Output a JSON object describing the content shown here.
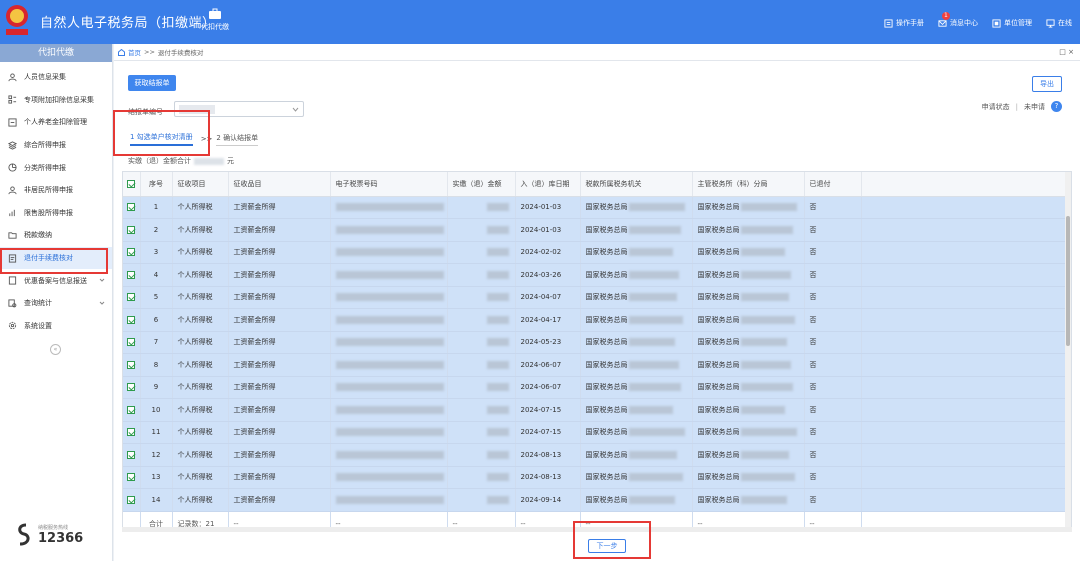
{
  "header": {
    "app_title": "自然人电子税务局（扣缴端）",
    "proxy_label": "代扣代缴",
    "links": [
      {
        "label": "操作手册",
        "icon": "manual-icon"
      },
      {
        "label": "消息中心",
        "icon": "message-icon",
        "badge": "1"
      },
      {
        "label": "单位管理",
        "icon": "org-icon"
      },
      {
        "label": "在线",
        "icon": "online-icon"
      }
    ]
  },
  "sidebar": {
    "title": "代扣代缴",
    "items": [
      {
        "label": "人员信息采集",
        "icon": "person-icon"
      },
      {
        "label": "专项附加扣除信息采集",
        "icon": "list-icon"
      },
      {
        "label": "个人养老金扣除管理",
        "icon": "pension-icon"
      },
      {
        "label": "综合所得申报",
        "icon": "layers-icon"
      },
      {
        "label": "分类所得申报",
        "icon": "pie-icon"
      },
      {
        "label": "非居民所得申报",
        "icon": "nonresident-icon"
      },
      {
        "label": "限售股所得申报",
        "icon": "stock-icon"
      },
      {
        "label": "税款缴纳",
        "icon": "folder-icon"
      },
      {
        "label": "退付手续费核对",
        "icon": "doc-check-icon"
      },
      {
        "label": "优惠备案与信息报送",
        "icon": "file-icon"
      },
      {
        "label": "查询统计",
        "icon": "query-icon"
      },
      {
        "label": "系统设置",
        "icon": "gear-icon"
      }
    ],
    "collapse_glyph": "«",
    "hotline": {
      "number": "12366",
      "caption": "纳税服务热线"
    }
  },
  "breadcrumb": {
    "home": "首页",
    "sep": ">>",
    "current": "退付手续费核对",
    "close": "□ ×"
  },
  "toolbar": {
    "fetch_label": "获取结报单",
    "export_label": "导出"
  },
  "form": {
    "report_no_label": "结报单编号"
  },
  "status": {
    "label": "申请状态",
    "value": "未申请",
    "help": "?"
  },
  "steps": {
    "step1": "1 勾选单户核对清册",
    "sep": ">>",
    "step2": "2 确认结报单"
  },
  "total": {
    "label": "实缴（退）金额合计",
    "unit": "元"
  },
  "table": {
    "columns": [
      "序号",
      "征收项目",
      "征收品目",
      "电子税票号码",
      "实缴（退）金额",
      "入（退）库日期",
      "税款所属税务机关",
      "主管税务所（科）分局",
      "已退付"
    ],
    "rows": [
      {
        "no": "1",
        "item": "个人所得税",
        "sub": "工资薪金所得",
        "date": "2024-01-03",
        "auth": "国家税务总局",
        "office": "国家税务总局",
        "refunded": "否"
      },
      {
        "no": "2",
        "item": "个人所得税",
        "sub": "工资薪金所得",
        "date": "2024-01-03",
        "auth": "国家税务总局",
        "office": "国家税务总局",
        "refunded": "否"
      },
      {
        "no": "3",
        "item": "个人所得税",
        "sub": "工资薪金所得",
        "date": "2024-02-02",
        "auth": "国家税务总局",
        "office": "国家税务总局",
        "refunded": "否"
      },
      {
        "no": "4",
        "item": "个人所得税",
        "sub": "工资薪金所得",
        "date": "2024-03-26",
        "auth": "国家税务总局",
        "office": "国家税务总局",
        "refunded": "否"
      },
      {
        "no": "5",
        "item": "个人所得税",
        "sub": "工资薪金所得",
        "date": "2024-04-07",
        "auth": "国家税务总局",
        "office": "国家税务总局",
        "refunded": "否"
      },
      {
        "no": "6",
        "item": "个人所得税",
        "sub": "工资薪金所得",
        "date": "2024-04-17",
        "auth": "国家税务总局",
        "office": "国家税务总局",
        "refunded": "否"
      },
      {
        "no": "7",
        "item": "个人所得税",
        "sub": "工资薪金所得",
        "date": "2024-05-23",
        "auth": "国家税务总局",
        "office": "国家税务总局",
        "refunded": "否"
      },
      {
        "no": "8",
        "item": "个人所得税",
        "sub": "工资薪金所得",
        "date": "2024-06-07",
        "auth": "国家税务总局",
        "office": "国家税务总局",
        "refunded": "否"
      },
      {
        "no": "9",
        "item": "个人所得税",
        "sub": "工资薪金所得",
        "date": "2024-06-07",
        "auth": "国家税务总局",
        "office": "国家税务总局",
        "refunded": "否"
      },
      {
        "no": "10",
        "item": "个人所得税",
        "sub": "工资薪金所得",
        "date": "2024-07-15",
        "auth": "国家税务总局",
        "office": "国家税务总局",
        "refunded": "否"
      },
      {
        "no": "11",
        "item": "个人所得税",
        "sub": "工资薪金所得",
        "date": "2024-07-15",
        "auth": "国家税务总局",
        "office": "国家税务总局",
        "refunded": "否"
      },
      {
        "no": "12",
        "item": "个人所得税",
        "sub": "工资薪金所得",
        "date": "2024-08-13",
        "auth": "国家税务总局",
        "office": "国家税务总局",
        "refunded": "否"
      },
      {
        "no": "13",
        "item": "个人所得税",
        "sub": "工资薪金所得",
        "date": "2024-08-13",
        "auth": "国家税务总局",
        "office": "国家税务总局",
        "refunded": "否"
      },
      {
        "no": "14",
        "item": "个人所得税",
        "sub": "工资薪金所得",
        "date": "2024-09-14",
        "auth": "国家税务总局",
        "office": "国家税务总局",
        "refunded": "否"
      }
    ],
    "footer": {
      "label": "合计",
      "count": "记录数：21",
      "dash": "--"
    }
  },
  "next_label": "下一步",
  "colors": {
    "header": "#3a7ee8",
    "row_selected": "#cfe1f8",
    "highlight": "#e53935"
  }
}
